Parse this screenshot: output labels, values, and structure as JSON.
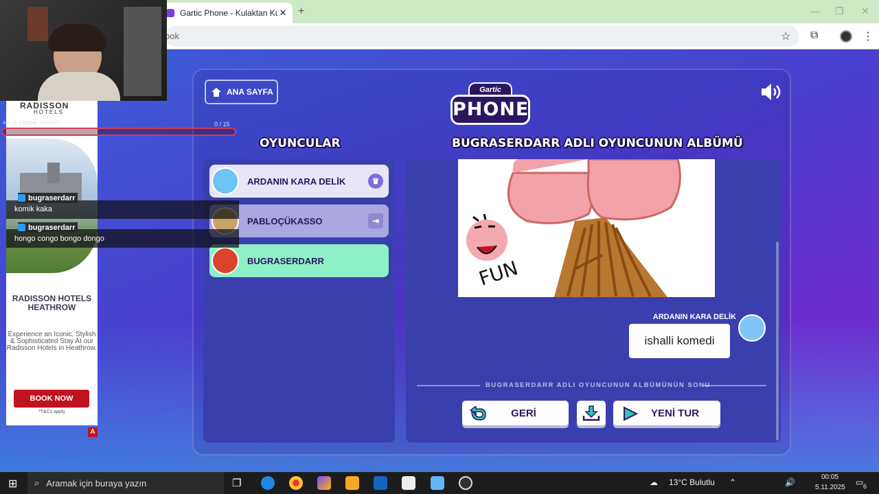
{
  "browser": {
    "tab_title": "Gartic Phone - Kulaktan Kulağa",
    "tab_close": "✕",
    "new_tab": "+",
    "address_text": "ook",
    "window_minimize": "—",
    "window_maximize": "❐",
    "window_close": "✕"
  },
  "game": {
    "home_label": "ANA SAYFA",
    "logo_top": "Gartic",
    "logo_main": "PHONE",
    "players_title": "OYUNCULAR",
    "album_title": "BUGRASERDARR ADLI OYUNCUNUN ALBÜMÜ",
    "players": [
      {
        "name": "ARDANIN KARA DELİK",
        "state": "host",
        "avatar_color": "#6ec3f2",
        "bg": "#e7e6f8"
      },
      {
        "name": "PABLOÇÜKASSO",
        "state": "left",
        "avatar_color": "#c9a46a",
        "bg": "#a9a6e0"
      },
      {
        "name": "BUGRASERDARR",
        "state": "selected",
        "avatar_color": "#d9452c",
        "bg": "#8ef0c5"
      }
    ],
    "drawing_text": "FUN",
    "message": {
      "author": "ARDANIN KARA DELİK",
      "text": "ishalli komedi"
    },
    "album_end": "BUGRASERDARR ADLI OYUNCUNUN ALBÜMÜNÜN SONU",
    "back_label": "GERİ",
    "new_round_label": "YENİ TUR",
    "accent": "#8ef0c5"
  },
  "overlay": {
    "ad_brand": "RADISSON",
    "ad_brand_sub": "HOTELS",
    "ad_headline": "RADISSON HOTELS HEATHROW",
    "ad_body": "Experience an Iconic, Stylish & Sophisticated Stay At our Radisson Hotels in Heathrow.",
    "ad_cta": "BOOK NOW",
    "ad_tc": "*T&Cs apply",
    "ad_mark": "A",
    "sub_goal_label": "AYLIK ABONE HEDEFİ",
    "sub_goal_count": "0 / 15",
    "chat": [
      {
        "user": "bugraserdarr",
        "message": "komik kaka"
      },
      {
        "user": "bugraserdarr",
        "message": "hongo congo bongo dongo"
      }
    ]
  },
  "taskbar": {
    "search_placeholder": "Aramak için buraya yazın",
    "weather": "13°C  Bulutlu",
    "time": "00:05",
    "date": "5.11.2025",
    "notif_count": "6"
  }
}
